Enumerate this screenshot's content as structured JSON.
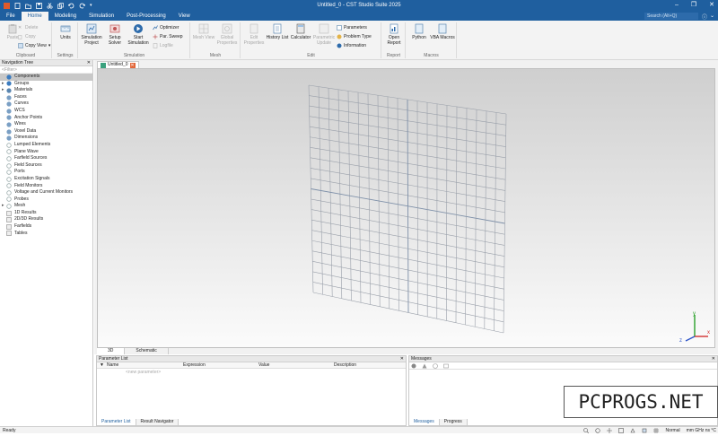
{
  "app": {
    "window_title": "Untitled_0 - CST Studio Suite 2025",
    "search_placeholder": "Search (Alt+Q)"
  },
  "tabs": [
    "File",
    "Home",
    "Modeling",
    "Simulation",
    "Post-Processing",
    "View"
  ],
  "ribbon": {
    "clipboard": {
      "label": "Clipboard",
      "paste": "Paste",
      "delete": "Delete",
      "copy": "Copy",
      "copy_view": "Copy View"
    },
    "settings": {
      "label": "Settings",
      "units": "Units"
    },
    "simulation": {
      "label": "Simulation",
      "sim_project": "Simulation Project",
      "setup_solver": "Setup Solver",
      "start_sim": "Start Simulation",
      "optimizer": "Optimizer",
      "par_sweep": "Par. Sweep",
      "logfile": "Logfile"
    },
    "mesh": {
      "label": "Mesh",
      "mesh_view": "Mesh View",
      "global_props": "Global Properties"
    },
    "edit": {
      "label": "Edit",
      "edit_props": "Edit Properties",
      "history_list": "History List",
      "calculator": "Calculator",
      "param_update": "Parametric Update",
      "parameters": "Parameters",
      "problem_type": "Problem Type",
      "information": "Information"
    },
    "report": {
      "label": "Report",
      "open_report": "Open Report"
    },
    "macros": {
      "label": "Macros",
      "python": "Python",
      "vba_macros": "VBA Macros"
    }
  },
  "nav": {
    "title": "Navigation Tree",
    "filter_placeholder": "<Filter>",
    "items": [
      "Components",
      "Groups",
      "Materials",
      "Faces",
      "Curves",
      "WCS",
      "Anchor Points",
      "Wires",
      "Voxel Data",
      "Dimensions",
      "Lumped Elements",
      "Plane Wave",
      "Farfield Sources",
      "Field Sources",
      "Ports",
      "Excitation Signals",
      "Field Monitors",
      "Voltage and Current Monitors",
      "Probes",
      "Mesh",
      "1D Results",
      "2D/3D Results",
      "Farfields",
      "Tables"
    ]
  },
  "document": {
    "tab_title": "Untitled_0",
    "view_tabs": [
      "3D",
      "Schematic"
    ]
  },
  "axes": {
    "x": "x",
    "y": "y",
    "z": "z"
  },
  "parameters": {
    "title": "Parameter List",
    "columns": [
      "Name",
      "Expression",
      "Value",
      "Description"
    ],
    "new_row": "<new parameter>",
    "tabs": [
      "Parameter List",
      "Result Navigator"
    ]
  },
  "messages": {
    "title": "Messages",
    "tabs": [
      "Messages",
      "Progress"
    ]
  },
  "status": {
    "left": "Ready",
    "mode": "Normal",
    "units": "mm GHz ns °C"
  },
  "watermark": "PCPROGS.NET",
  "colors": {
    "accent": "#1f5f9f",
    "tree_selected": "#c8c8c8"
  }
}
